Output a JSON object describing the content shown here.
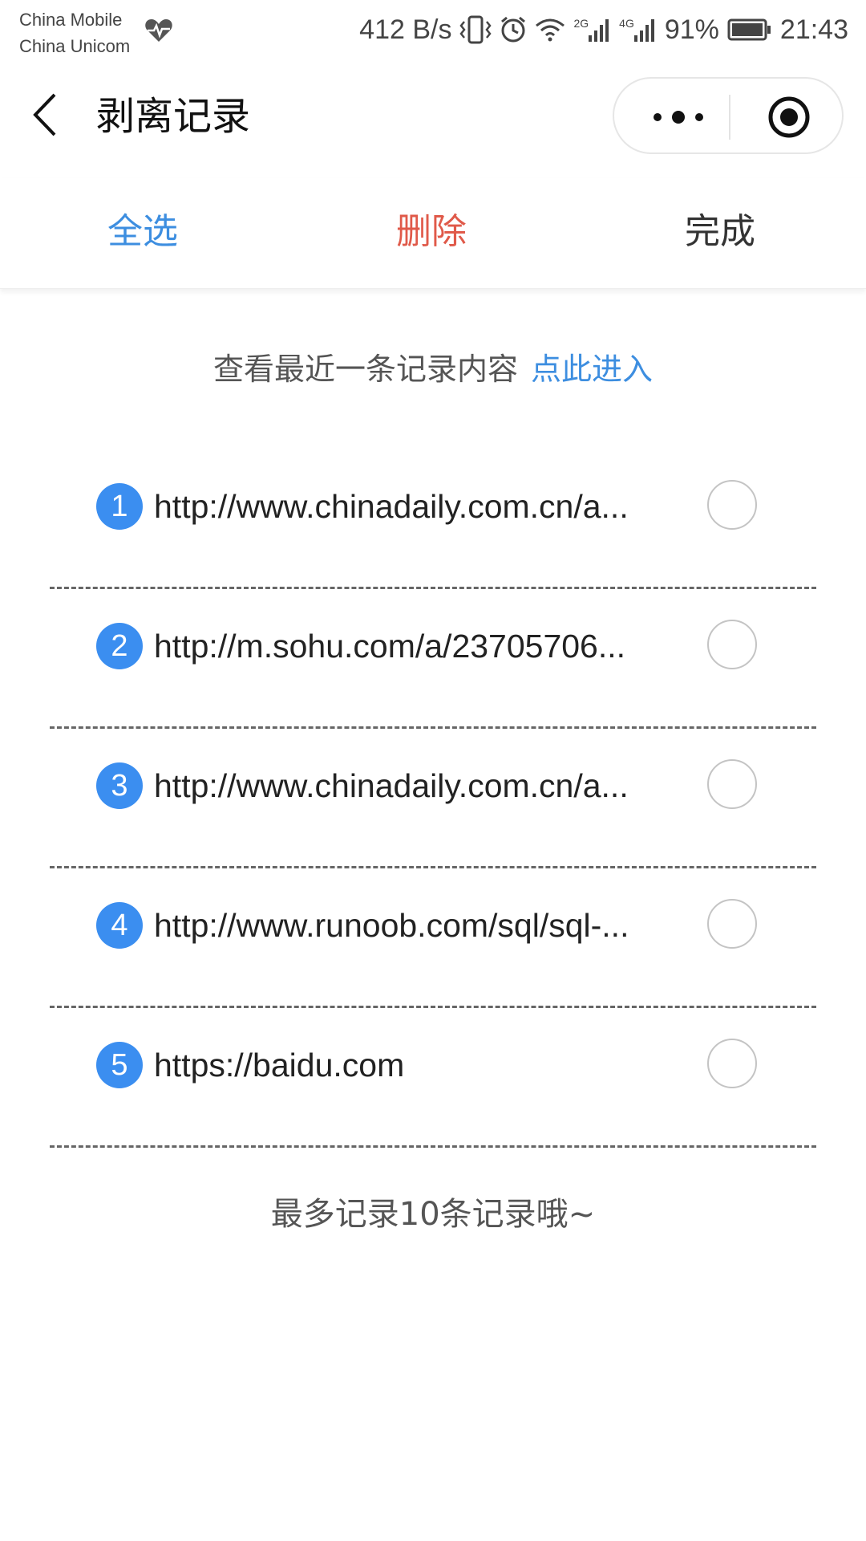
{
  "status_bar": {
    "carrier_1": "China Mobile",
    "carrier_2": "China Unicom",
    "net_speed": "412 B/s",
    "signal_1_type": "2G",
    "signal_2_type": "4G",
    "battery_percent": "91%",
    "time": "21:43",
    "icons": [
      "heart-health-icon",
      "vibrate-icon",
      "alarm-icon",
      "wifi-icon",
      "signal-icon",
      "battery-icon"
    ]
  },
  "navbar": {
    "title": "剥离记录",
    "back_icon": "chevron-left-icon",
    "more_icon": "more-dots-icon",
    "close_icon": "target-circle-icon"
  },
  "toolbar": {
    "select_all": "全选",
    "delete": "删除",
    "done": "完成"
  },
  "hint": {
    "text": "查看最近一条记录内容",
    "link": "点此进入"
  },
  "records": [
    {
      "index": "1",
      "url": "http://www.chinadaily.com.cn/a..."
    },
    {
      "index": "2",
      "url": "http://m.sohu.com/a/23705706..."
    },
    {
      "index": "3",
      "url": "http://www.chinadaily.com.cn/a..."
    },
    {
      "index": "4",
      "url": "http://www.runoob.com/sql/sql-..."
    },
    {
      "index": "5",
      "url": "https://baidu.com"
    }
  ],
  "footer": {
    "text": "最多记录10条记录哦~"
  },
  "colors": {
    "accent_blue": "#3d8ee0",
    "badge_blue": "#3b8ef0",
    "delete_red": "#e05a4a"
  }
}
